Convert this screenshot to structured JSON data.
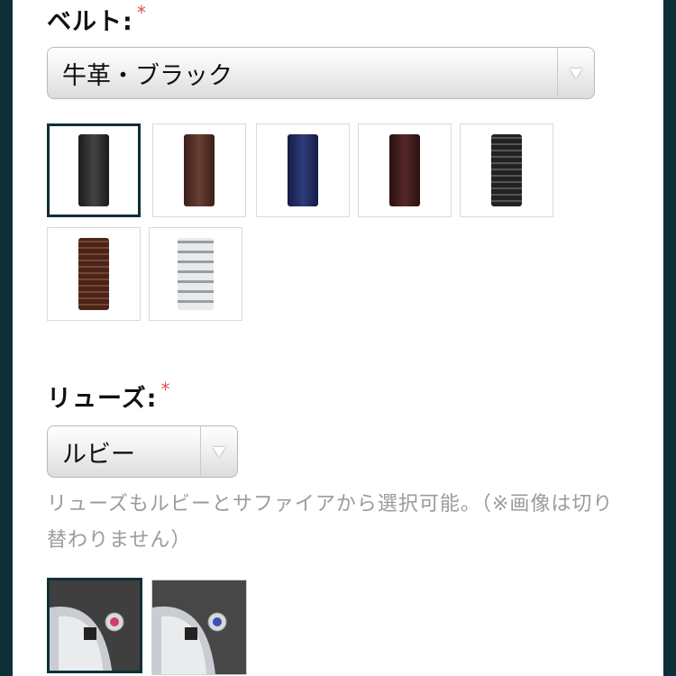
{
  "belt": {
    "label": "ベルト:",
    "required_mark": "*",
    "selected_value": "牛革・ブラック",
    "swatches": [
      {
        "name": "black-leather",
        "color": "#2b2b2b",
        "selected": true
      },
      {
        "name": "brown-leather",
        "color": "#4a2a22",
        "selected": false
      },
      {
        "name": "navy-leather",
        "color": "#1f2a5a",
        "selected": false
      },
      {
        "name": "burgundy-leather",
        "color": "#3a1a1a",
        "selected": false
      },
      {
        "name": "black-croc",
        "color": "#303030",
        "selected": false
      },
      {
        "name": "brown-croc",
        "color": "#5a2e22",
        "selected": false
      },
      {
        "name": "metal-bracelet",
        "color": "#b8bcc0",
        "selected": false
      }
    ]
  },
  "crown": {
    "label": "リューズ:",
    "required_mark": "*",
    "selected_value": "ルビー",
    "hint": "リューズもルビーとサファイアから選択可能。（※画像は切り替わりません）",
    "options": [
      {
        "name": "ruby",
        "gem_color": "#d23c6a",
        "selected": true
      },
      {
        "name": "sapphire",
        "gem_color": "#3e4fb5",
        "selected": false
      }
    ]
  }
}
